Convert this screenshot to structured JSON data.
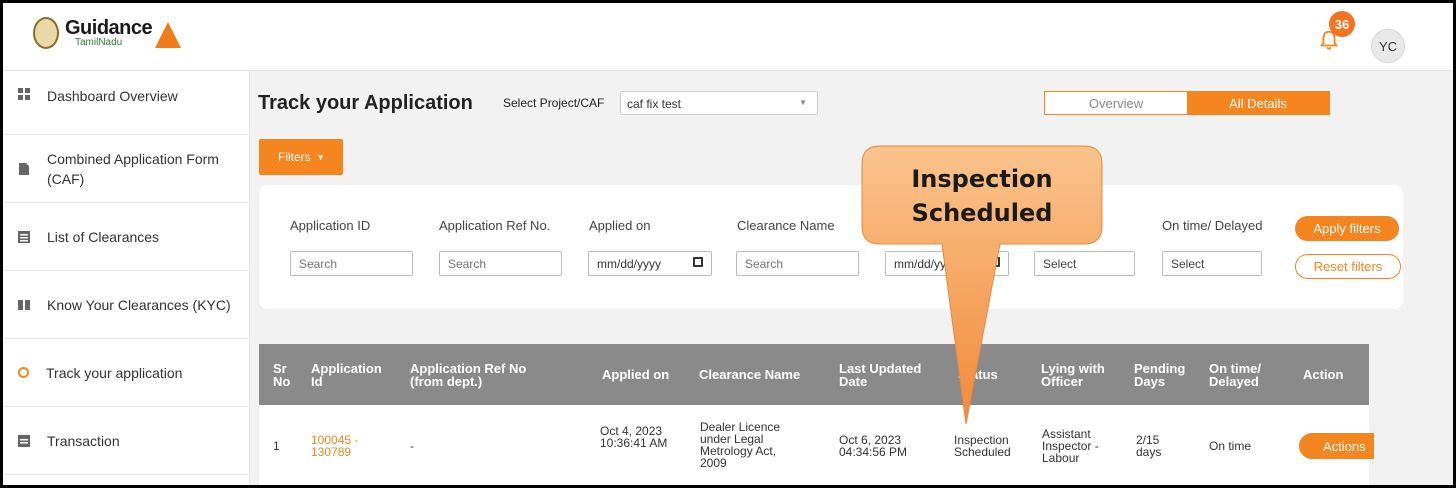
{
  "header": {
    "brand_main": "Guidance",
    "brand_sub": "TamilNadu",
    "notifications_count": "36",
    "user_initials": "YC"
  },
  "sidebar": {
    "items": [
      {
        "label": "Dashboard Overview",
        "icon": "dashboard-icon"
      },
      {
        "label": "Combined Application Form (CAF)",
        "icon": "document-icon"
      },
      {
        "label": "List of Clearances",
        "icon": "list-icon"
      },
      {
        "label": "Know Your Clearances (KYC)",
        "icon": "book-icon"
      },
      {
        "label": "Track your application",
        "icon": "location-icon",
        "active": true
      },
      {
        "label": "Transaction",
        "icon": "transaction-icon"
      }
    ]
  },
  "main": {
    "title": "Track your Application",
    "project_label": "Select Project/CAF",
    "project_value": "caf fix test",
    "view_toggle": {
      "overview": "Overview",
      "all_details": "All Details",
      "selected": "All Details"
    },
    "filters_button": "Filters",
    "filters": {
      "application_id": {
        "label": "Application ID",
        "placeholder": "Search"
      },
      "application_ref": {
        "label": "Application Ref No.",
        "placeholder": "Search"
      },
      "applied_on": {
        "label": "Applied on",
        "placeholder": "mm/dd/yyyy"
      },
      "clearance_name": {
        "label": "Clearance Name",
        "placeholder": "Search"
      },
      "last_updated": {
        "placeholder": "mm/dd/yyyy"
      },
      "status": {
        "placeholder": "Select"
      },
      "on_time": {
        "label": "On time/ Delayed",
        "placeholder": "Select"
      },
      "apply": "Apply filters",
      "reset": "Reset filters"
    },
    "table": {
      "columns": [
        "Sr No",
        "Application Id",
        "Application Ref No (from dept.)",
        "Applied on",
        "Clearance Name",
        "Last Updated Date",
        "Status",
        "Lying with Officer",
        "Pending Days",
        "On time/ Delayed",
        "Action"
      ],
      "rows": [
        {
          "sr_no": "1",
          "application_id": "100045 - 130789",
          "application_ref": "-",
          "applied_on": "Oct 4, 2023 10:36:41 AM",
          "clearance_name": "Dealer Licence under Legal Metrology Act, 2009",
          "last_updated": "Oct 6, 2023 04:34:56 PM",
          "status": "Inspection Scheduled",
          "lying_with": "Assistant Inspector - Labour",
          "pending_days": "2/15 days",
          "on_time": "On time",
          "action": "Actions"
        }
      ]
    }
  },
  "callout": {
    "text": "Inspection Scheduled"
  },
  "colors": {
    "accent": "#f5851f",
    "table_header": "#8a8a8a",
    "callout": "#f7a35c"
  }
}
